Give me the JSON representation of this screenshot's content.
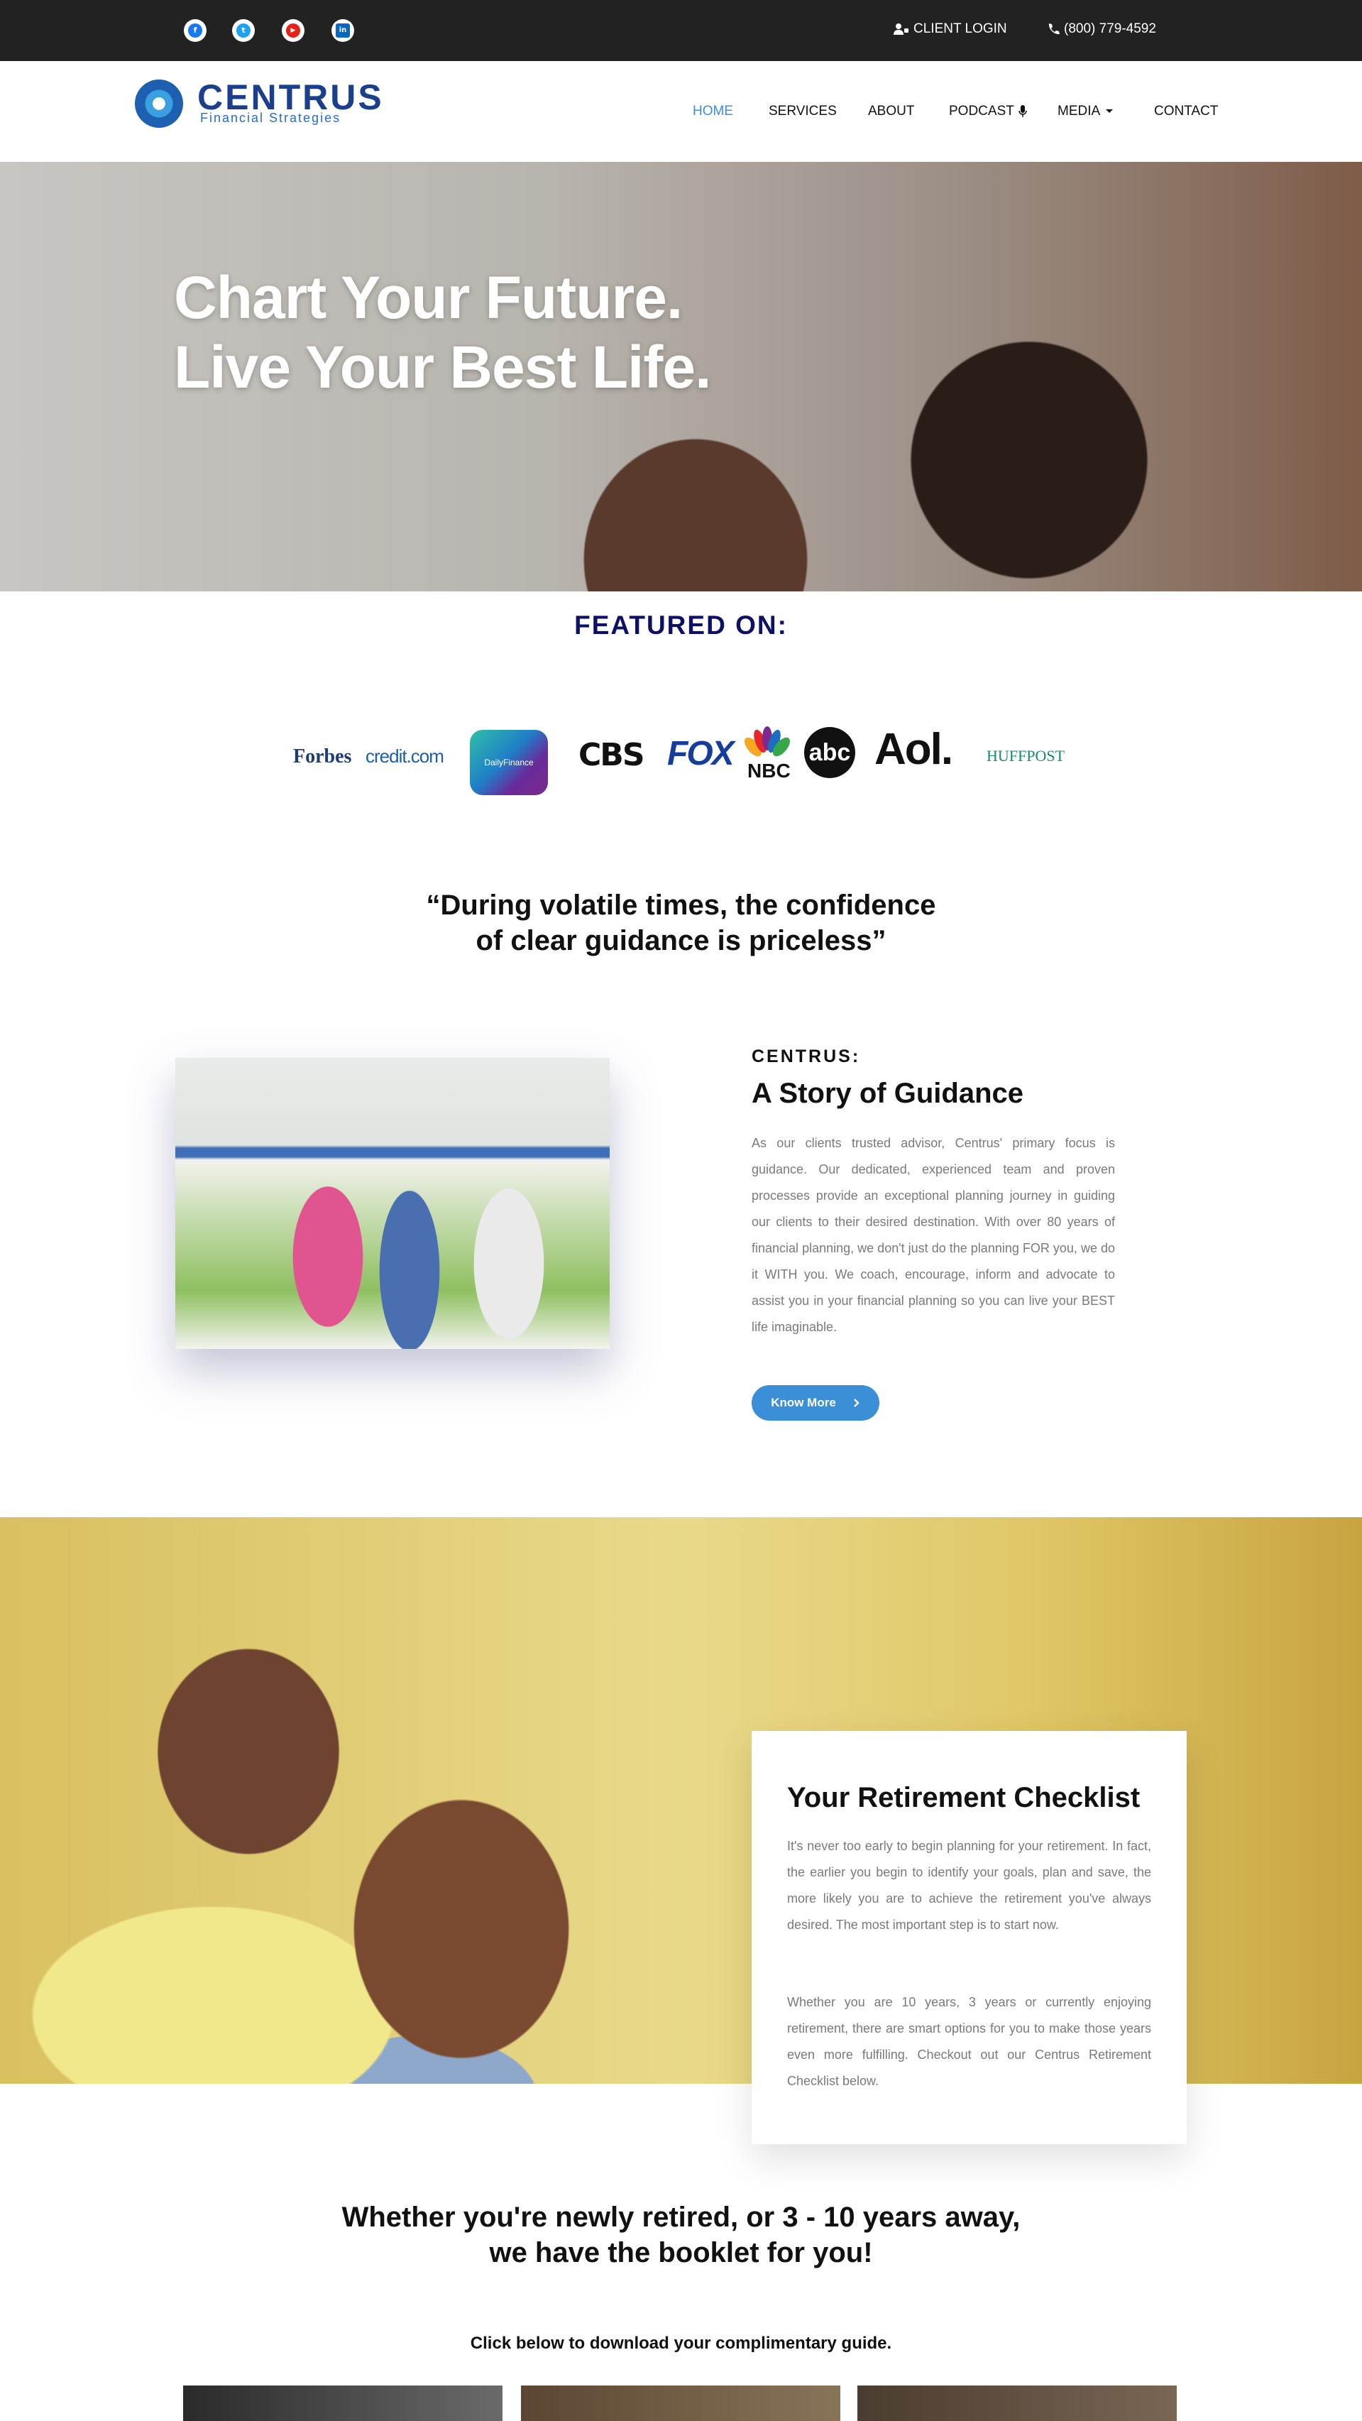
{
  "topbar": {
    "social": [
      {
        "name": "facebook-icon",
        "glyph": "f",
        "color": "#1877f2"
      },
      {
        "name": "twitter-icon",
        "glyph": "t",
        "color": "#1da1f2"
      },
      {
        "name": "youtube-icon",
        "glyph": "▶",
        "color": "#e62117"
      },
      {
        "name": "linkedin-icon",
        "glyph": "in",
        "color": "#0a66c2"
      }
    ],
    "client_login": "CLIENT LOGIN",
    "phone": "(800) 779-4592"
  },
  "brand": {
    "name": "CENTRUS",
    "tagline": "Financial Strategies"
  },
  "nav": {
    "home": "HOME",
    "services": "SERVICES",
    "about": "ABOUT",
    "podcast": "PODCAST",
    "media": "MEDIA",
    "contact": "CONTACT"
  },
  "hero": {
    "line1": "Chart Your Future.",
    "line2": "Live Your Best Life."
  },
  "featured": {
    "heading": "FEATURED ON:",
    "logos": {
      "forbes": "Forbes",
      "credit": "credit.com",
      "dailyfinance": "DailyFinance",
      "cbs": "CBS",
      "fox": "FOX",
      "nbc": "NBC",
      "abc": "abc",
      "aol": "Aol.",
      "huffpost": "HUFFPOST"
    }
  },
  "quote": {
    "line1": "“During volatile times, the confidence",
    "line2": "of clear guidance is priceless”"
  },
  "story": {
    "label": "CENTRUS:",
    "title": "A Story of Guidance",
    "body": "As our clients trusted advisor, Centrus' primary focus is guidance. Our dedicated, experienced team and proven processes provide an exceptional planning journey in guiding our clients to their desired destination. With over 80 years of financial planning, we don't just do the planning FOR you, we do it WITH you. We coach, encourage, inform and advocate to assist you in your financial planning so you can live your BEST life imaginable.",
    "button": "Know More"
  },
  "retirement": {
    "title": "Your Retirement Checklist",
    "p1": "It's never too early to begin planning for your retirement. In fact, the earlier you begin to identify your goals, plan and save, the more likely you are to achieve the retirement you've always desired.  The most important step is to start now.",
    "p2": "Whether you are 10 years, 3 years or currently enjoying retirement, there are smart options for you to make those years even more fulfilling. Checkout out our Centrus Retirement Checklist below."
  },
  "booklet": {
    "line1": "Whether you're newly retired, or 3 - 10 years away,",
    "line2": "we have the booklet for you!",
    "cta": "Click below to download your complimentary guide."
  },
  "colors": {
    "accent": "#3a8de0",
    "navy": "#0d1166",
    "topbar": "#222222"
  }
}
